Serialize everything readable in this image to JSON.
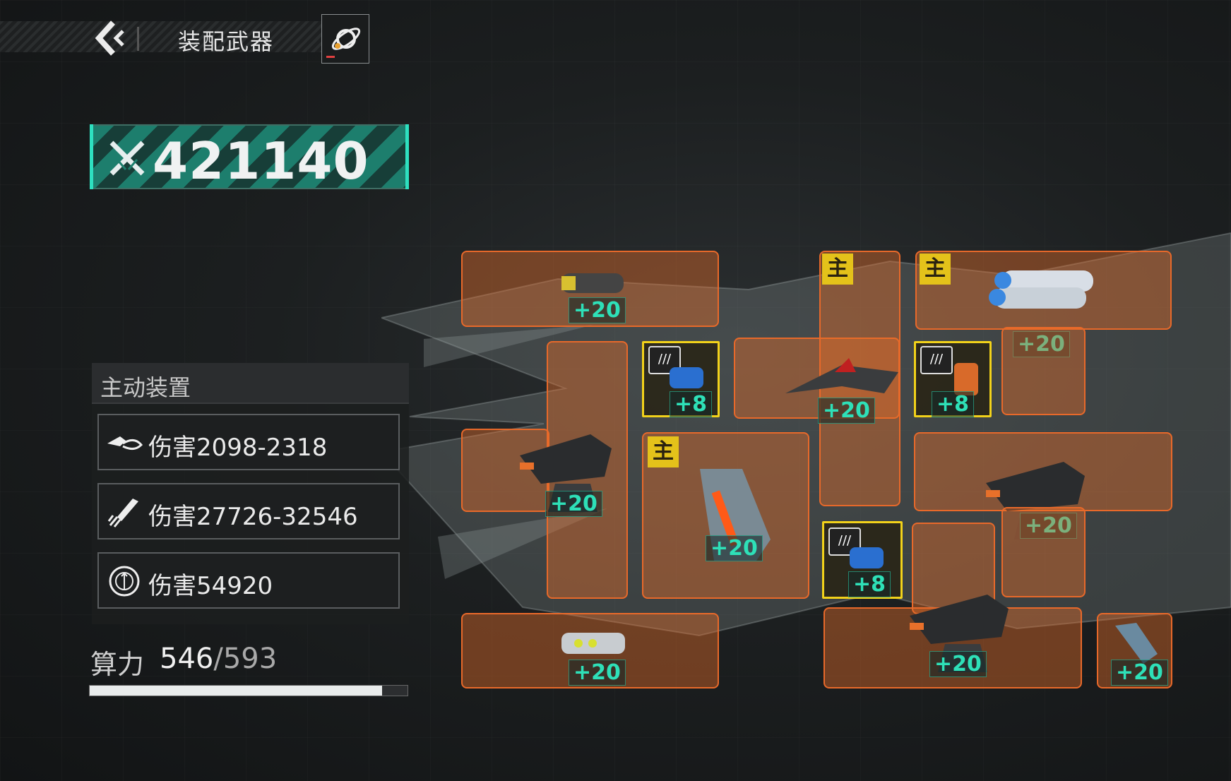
{
  "header": {
    "title": "装配武器"
  },
  "power": {
    "value": "421140"
  },
  "active_devices": {
    "heading": "主动装置",
    "items": [
      {
        "icon": "drone-icon",
        "text": "伤害2098-2318"
      },
      {
        "icon": "missile-icon",
        "text": "伤害27726-32546"
      },
      {
        "icon": "target-icon",
        "text": "伤害54920"
      }
    ]
  },
  "compute": {
    "label": "算力",
    "current": "546",
    "max": "/593",
    "fraction": 0.92
  },
  "slots": {
    "main_tag": "主",
    "spd_tag": "///",
    "badges": {
      "s1": "+20",
      "s2": "+20",
      "s3": "+8",
      "s4": "+20",
      "s5": "+8",
      "s6": "+20",
      "s7": "+20",
      "s8": "+20",
      "s9": "+8",
      "s10": "+20",
      "s11": "+20",
      "s12": "+20"
    }
  },
  "colors": {
    "accent_teal": "#2ee0c0",
    "slot_orange": "#e8692a",
    "slot_yellow": "#f2d21a",
    "main_tag": "#e4c21a"
  }
}
